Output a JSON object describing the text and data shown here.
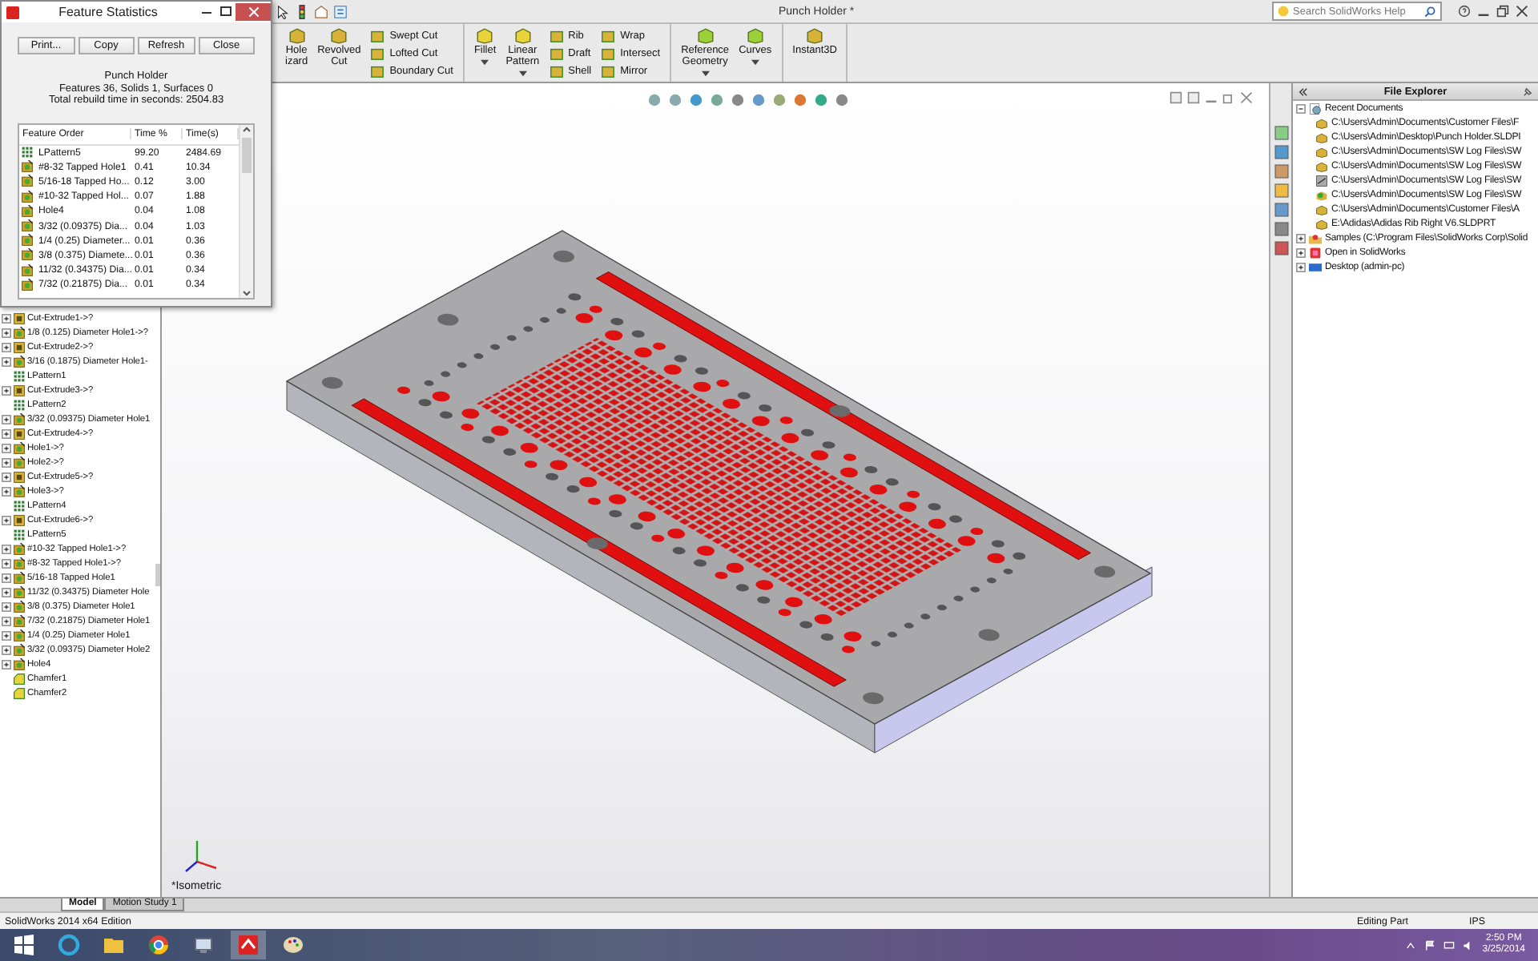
{
  "app_title": "Punch Holder *",
  "help_search": {
    "placeholder": "Search SolidWorks Help"
  },
  "command_manager": {
    "sections": [
      [
        {
          "kind": "large",
          "lines": [
            "Hole",
            "izard"
          ],
          "dropdown": false
        },
        {
          "kind": "large",
          "lines": [
            "Revolved",
            "Cut"
          ],
          "dropdown": false
        },
        {
          "kind": "stack",
          "items": [
            "Swept Cut",
            "Lofted Cut",
            "Boundary Cut"
          ]
        }
      ],
      [
        {
          "kind": "large",
          "lines": [
            "Fillet"
          ],
          "dropdown": true
        },
        {
          "kind": "large",
          "lines": [
            "Linear",
            "Pattern"
          ],
          "dropdown": true
        },
        {
          "kind": "stack",
          "items": [
            "Rib",
            "Draft",
            "Shell"
          ]
        },
        {
          "kind": "stack",
          "items": [
            "Wrap",
            "Intersect",
            "Mirror"
          ]
        }
      ],
      [
        {
          "kind": "large",
          "lines": [
            "Reference",
            "Geometry"
          ],
          "dropdown": true
        },
        {
          "kind": "large",
          "lines": [
            "Curves"
          ],
          "dropdown": true
        }
      ],
      [
        {
          "kind": "large",
          "lines": [
            "Instant3D"
          ],
          "dropdown": false
        }
      ]
    ]
  },
  "feature_statistics": {
    "title": "Feature Statistics",
    "buttons": [
      "Print...",
      "Copy",
      "Refresh",
      "Close"
    ],
    "part": "Punch Holder",
    "summary": "Features 36, Solids 1, Surfaces 0",
    "total": "Total rebuild time in seconds: 2504.83",
    "columns": [
      "Feature Order",
      "Time %",
      "Time(s)"
    ],
    "rows": [
      {
        "kind": "pattern",
        "name": "LPattern5",
        "percent": "99.20",
        "seconds": "2484.69"
      },
      {
        "kind": "hole",
        "name": "#8-32 Tapped Hole1",
        "percent": "0.41",
        "seconds": "10.34"
      },
      {
        "kind": "hole",
        "name": "5/16-18 Tapped Ho...",
        "percent": "0.12",
        "seconds": "3.00"
      },
      {
        "kind": "hole",
        "name": "#10-32 Tapped Hol...",
        "percent": "0.07",
        "seconds": "1.88"
      },
      {
        "kind": "hole",
        "name": "Hole4",
        "percent": "0.04",
        "seconds": "1.08"
      },
      {
        "kind": "hole",
        "name": "3/32 (0.09375) Dia...",
        "percent": "0.04",
        "seconds": "1.03"
      },
      {
        "kind": "hole",
        "name": "1/4 (0.25) Diameter...",
        "percent": "0.01",
        "seconds": "0.36"
      },
      {
        "kind": "hole",
        "name": "3/8 (0.375) Diamete...",
        "percent": "0.01",
        "seconds": "0.36"
      },
      {
        "kind": "hole",
        "name": "11/32 (0.34375) Dia...",
        "percent": "0.01",
        "seconds": "0.34"
      },
      {
        "kind": "hole",
        "name": "7/32 (0.21875) Dia...",
        "percent": "0.01",
        "seconds": "0.34"
      }
    ]
  },
  "feature_tree": [
    {
      "kind": "cut",
      "name": "Cut-Extrude1->?",
      "expander": true
    },
    {
      "kind": "hole",
      "name": "1/8 (0.125) Diameter Hole1->?",
      "expander": true
    },
    {
      "kind": "cut",
      "name": "Cut-Extrude2->?",
      "expander": true
    },
    {
      "kind": "hole",
      "name": "3/16 (0.1875) Diameter Hole1-",
      "expander": true
    },
    {
      "kind": "pattern",
      "name": "LPattern1",
      "expander": false
    },
    {
      "kind": "cut",
      "name": "Cut-Extrude3->?",
      "expander": true
    },
    {
      "kind": "pattern",
      "name": "LPattern2",
      "expander": false
    },
    {
      "kind": "hole",
      "name": "3/32 (0.09375) Diameter Hole1",
      "expander": true
    },
    {
      "kind": "cut",
      "name": "Cut-Extrude4->?",
      "expander": true
    },
    {
      "kind": "hole",
      "name": "Hole1->?",
      "expander": true
    },
    {
      "kind": "hole",
      "name": "Hole2->?",
      "expander": true
    },
    {
      "kind": "cut",
      "name": "Cut-Extrude5->?",
      "expander": true
    },
    {
      "kind": "hole",
      "name": "Hole3->?",
      "expander": true
    },
    {
      "kind": "pattern",
      "name": "LPattern4",
      "expander": false
    },
    {
      "kind": "cut",
      "name": "Cut-Extrude6->?",
      "expander": true
    },
    {
      "kind": "pattern",
      "name": "LPattern5",
      "expander": false
    },
    {
      "kind": "hole",
      "name": "#10-32 Tapped Hole1->?",
      "expander": true
    },
    {
      "kind": "hole",
      "name": "#8-32 Tapped Hole1->?",
      "expander": true
    },
    {
      "kind": "hole",
      "name": "5/16-18 Tapped Hole1",
      "expander": true
    },
    {
      "kind": "hole",
      "name": "11/32 (0.34375) Diameter Hole",
      "expander": true
    },
    {
      "kind": "hole",
      "name": "3/8 (0.375) Diameter Hole1",
      "expander": true
    },
    {
      "kind": "hole",
      "name": "7/32 (0.21875) Diameter Hole1",
      "expander": true
    },
    {
      "kind": "hole",
      "name": "1/4 (0.25) Diameter Hole1",
      "expander": true
    },
    {
      "kind": "hole",
      "name": "3/32 (0.09375) Diameter Hole2",
      "expander": true
    },
    {
      "kind": "hole",
      "name": "Hole4",
      "expander": true
    },
    {
      "kind": "chamfer",
      "name": "Chamfer1",
      "expander": false
    },
    {
      "kind": "chamfer",
      "name": "Chamfer2",
      "expander": false
    }
  ],
  "viewport": {
    "view_label": "*Isometric"
  },
  "file_explorer": {
    "title": "File Explorer",
    "nodes": [
      {
        "kind": "recent",
        "label": "Recent Documents",
        "expanded": true,
        "children": [
          {
            "kind": "part",
            "label": "C:\\Users\\Admin\\Documents\\Customer Files\\F"
          },
          {
            "kind": "part",
            "label": "C:\\Users\\Admin\\Desktop\\Punch Holder.SLDPI"
          },
          {
            "kind": "part",
            "label": "C:\\Users\\Admin\\Documents\\SW Log Files\\SW"
          },
          {
            "kind": "part",
            "label": "C:\\Users\\Admin\\Documents\\SW Log Files\\SW"
          },
          {
            "kind": "drawing",
            "label": "C:\\Users\\Admin\\Documents\\SW Log Files\\SW"
          },
          {
            "kind": "assembly",
            "label": "C:\\Users\\Admin\\Documents\\SW Log Files\\SW"
          },
          {
            "kind": "part",
            "label": "C:\\Users\\Admin\\Documents\\Customer Files\\A"
          },
          {
            "kind": "part",
            "label": "E:\\Adidas\\Adidas Rib Right V6.SLDPRT"
          }
        ]
      },
      {
        "kind": "samples",
        "label": "Samples (C:\\Program Files\\SolidWorks Corp\\Solid",
        "expanded": false
      },
      {
        "kind": "open",
        "label": "Open in SolidWorks",
        "expanded": false
      },
      {
        "kind": "desktop",
        "label": "Desktop (admin-pc)",
        "expanded": false
      }
    ]
  },
  "bottom_tabs": [
    {
      "label": "Model",
      "selected": true
    },
    {
      "label": "Motion Study 1",
      "selected": false
    }
  ],
  "status_bar": {
    "edition": "SolidWorks 2014 x64 Edition",
    "mode": "Editing Part",
    "units": "IPS"
  },
  "taskbar": {
    "time": "2:50 PM",
    "date": "3/25/2014"
  }
}
